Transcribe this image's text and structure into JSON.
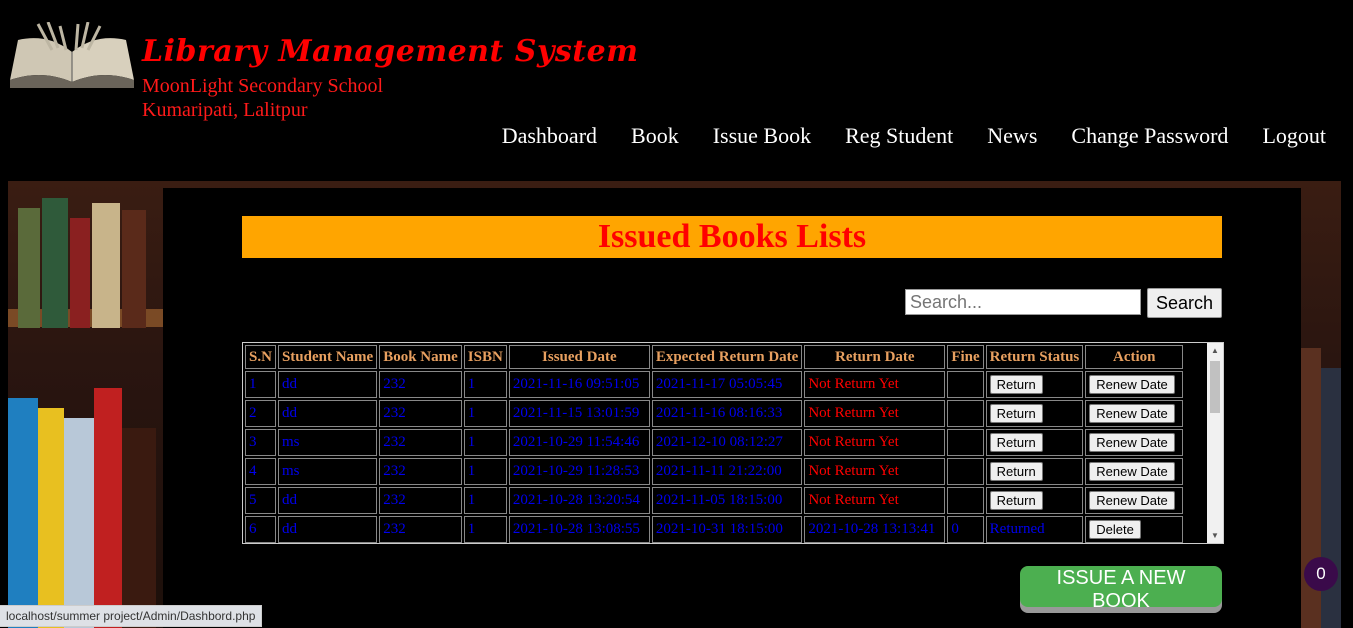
{
  "header": {
    "title": "Library Management System",
    "school_name": "MoonLight Secondary School",
    "location": "Kumaripati, Lalitpur"
  },
  "nav": [
    "Dashboard",
    "Book",
    "Issue Book",
    "Reg Student",
    "News",
    "Change Password",
    "Logout"
  ],
  "page": {
    "heading": "Issued Books Lists"
  },
  "search": {
    "placeholder": "Search...",
    "button_label": "Search"
  },
  "table": {
    "columns": [
      "S.N",
      "Student Name",
      "Book Name",
      "ISBN",
      "Issued Date",
      "Expected Return Date",
      "Return Date",
      "Fine",
      "Return Status",
      "Action"
    ],
    "rows": [
      {
        "sn": "1",
        "student": "dd",
        "book": "232",
        "isbn": "1",
        "issued": "2021-11-16 09:51:05",
        "expected": "2021-11-17 05:05:45",
        "returned": "Not Return Yet",
        "fine": "",
        "status_button": "Return",
        "action_button": "Renew Date"
      },
      {
        "sn": "2",
        "student": "dd",
        "book": "232",
        "isbn": "1",
        "issued": "2021-11-15 13:01:59",
        "expected": "2021-11-16 08:16:33",
        "returned": "Not Return Yet",
        "fine": "",
        "status_button": "Return",
        "action_button": "Renew Date"
      },
      {
        "sn": "3",
        "student": "ms",
        "book": "232",
        "isbn": "1",
        "issued": "2021-10-29 11:54:46",
        "expected": "2021-12-10 08:12:27",
        "returned": "Not Return Yet",
        "fine": "",
        "status_button": "Return",
        "action_button": "Renew Date"
      },
      {
        "sn": "4",
        "student": "ms",
        "book": "232",
        "isbn": "1",
        "issued": "2021-10-29 11:28:53",
        "expected": "2021-11-11 21:22:00",
        "returned": "Not Return Yet",
        "fine": "",
        "status_button": "Return",
        "action_button": "Renew Date"
      },
      {
        "sn": "5",
        "student": "dd",
        "book": "232",
        "isbn": "1",
        "issued": "2021-10-28 13:20:54",
        "expected": "2021-11-05 18:15:00",
        "returned": "Not Return Yet",
        "fine": "",
        "status_button": "Return",
        "action_button": "Renew Date"
      },
      {
        "sn": "6",
        "student": "dd",
        "book": "232",
        "isbn": "1",
        "issued": "2021-10-28 13:08:55",
        "expected": "2021-10-31 18:15:00",
        "returned": "2021-10-28 13:13:41",
        "fine": "0",
        "status_text": "Returned",
        "action_button": "Delete"
      }
    ]
  },
  "issue_button_label": "ISSUE A NEW BOOK",
  "badge_count": "0",
  "status_bar_url": "localhost/summer project/Admin/Dashbord.php",
  "colors": {
    "title_red": "#ff0000",
    "heading_bg": "#ffa500",
    "link_blue": "#0000ee",
    "header_text": "#e8a060",
    "issue_green": "#4caf50"
  }
}
